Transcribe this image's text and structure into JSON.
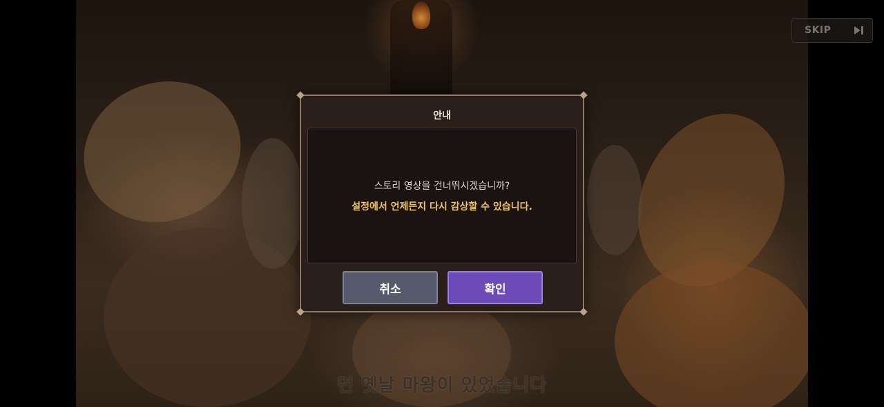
{
  "skip": {
    "label": "SKIP",
    "icon": "skip-forward-icon"
  },
  "subtitle": "먼 옛날 마왕이 있었습니다",
  "dialog": {
    "title": "안내",
    "message_line1": "스토리 영상을 건너뛰시겠습니까?",
    "message_line2": "설정에서 언제든지 다시 감상할 수 있습니다.",
    "cancel_label": "취소",
    "confirm_label": "확인"
  },
  "colors": {
    "highlight_text": "#f2c560",
    "confirm_button": "#6c4ab8",
    "cancel_button": "#555a6c",
    "dialog_border": "#8e7a66"
  }
}
